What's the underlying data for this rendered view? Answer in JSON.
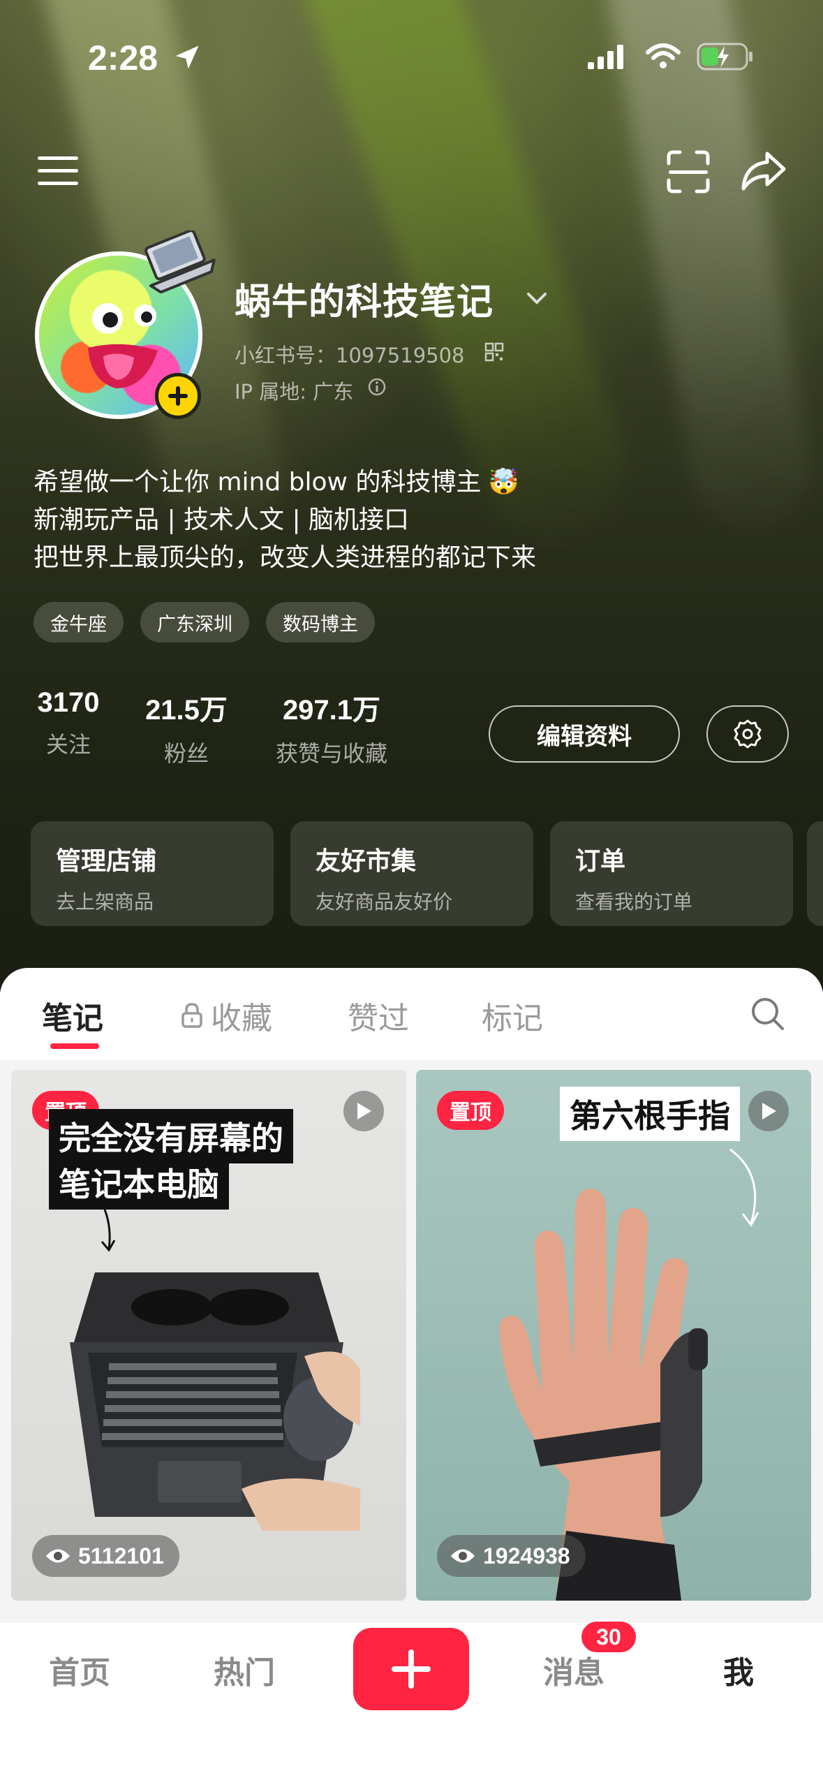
{
  "status_bar": {
    "time": "2:28",
    "icons": [
      "location-arrow-icon",
      "cellular-signal-icon",
      "wifi-icon",
      "battery-charging-icon"
    ]
  },
  "toolbar": {
    "icons": [
      "menu-icon",
      "scan-icon",
      "share-icon"
    ]
  },
  "profile": {
    "nickname": "蜗牛的科技笔记",
    "redbook_id": "小红书号：1097519508",
    "ip_location": "IP 属地: 广东",
    "bio_lines": [
      "希望做一个让你 mind blow 的科技博主",
      "新潮玩产品 | 技术人文 | 脑机接口",
      "把世界上最顶尖的，改变人类进程的都记下来"
    ],
    "bio_emoji": "🤯",
    "tags": [
      "金牛座",
      "广东深圳",
      "数码博主"
    ]
  },
  "stats": {
    "following": {
      "value": "3170",
      "label": "关注"
    },
    "fans": {
      "value": "21.5万",
      "label": "粉丝"
    },
    "likes": {
      "value": "297.1万",
      "label": "获赞与收藏"
    }
  },
  "actions": {
    "edit_profile": "编辑资料"
  },
  "shortcuts": [
    {
      "title": "管理店铺",
      "subtitle": "去上架商品"
    },
    {
      "title": "友好市集",
      "subtitle": "友好商品友好价"
    },
    {
      "title": "订单",
      "subtitle": "查看我的订单"
    }
  ],
  "tabs": {
    "notes": "笔记",
    "collections": "收藏",
    "liked": "赞过",
    "marked": "标记",
    "active": "notes"
  },
  "notes": [
    {
      "pin_label": "置顶",
      "caption_lines": [
        "完全没有屏幕的",
        "笔记本电脑"
      ],
      "views": "5112101",
      "has_video": true
    },
    {
      "pin_label": "置顶",
      "caption_lines": [
        "第六根手指"
      ],
      "views": "1924938",
      "has_video": true
    }
  ],
  "bottom_nav": {
    "home": "首页",
    "hot": "热门",
    "messages": "消息",
    "messages_badge": "30",
    "me": "我",
    "active": "me"
  },
  "colors": {
    "accent": "#ff2442",
    "avatar_badge": "#ffd500"
  }
}
